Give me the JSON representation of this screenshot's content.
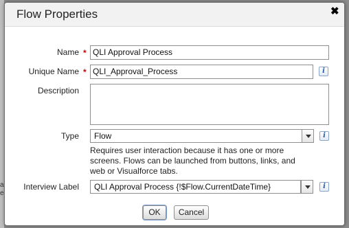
{
  "dialog": {
    "title": "Flow Properties",
    "close_glyph": "✖"
  },
  "form": {
    "name": {
      "label": "Name",
      "required_marker": "*",
      "value": "QLI Approval Process"
    },
    "unique_name": {
      "label": "Unique Name",
      "required_marker": "*",
      "value": "QLI_Approval_Process",
      "info_icon": "i"
    },
    "description": {
      "label": "Description",
      "value": ""
    },
    "type": {
      "label": "Type",
      "selected": "Flow",
      "info_icon": "i",
      "help_text": "Requires user interaction because it has one or more screens. Flows can be launched from buttons, links, and web or Visualforce tabs."
    },
    "interview_label": {
      "label": "Interview Label",
      "value": "QLI Approval Process {!$Flow.CurrentDateTime}",
      "info_icon": "i"
    }
  },
  "buttons": {
    "ok": "OK",
    "cancel": "Cancel"
  },
  "background": {
    "partial_text_1": "al",
    "partial_text_2": "er"
  },
  "colors": {
    "required": "#cc0000",
    "info_icon": "#2a5ba8",
    "header_bg": "#f2f2f2"
  }
}
